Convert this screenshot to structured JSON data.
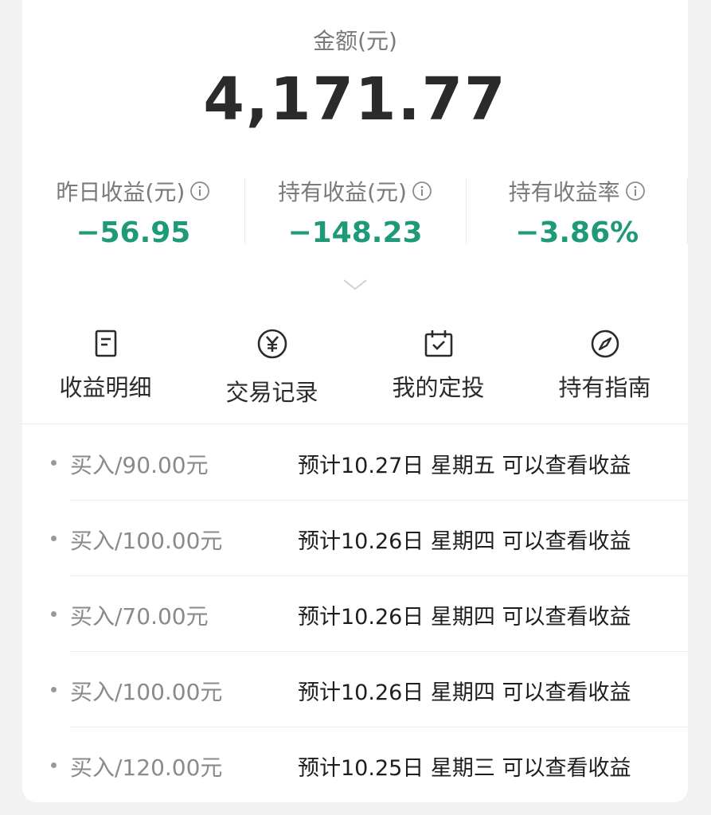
{
  "amount": {
    "label": "金额(元)",
    "value": "4,171.77"
  },
  "stats": [
    {
      "label": "昨日收益(元)",
      "value": "−56.95"
    },
    {
      "label": "持有收益(元)",
      "value": "−148.23"
    },
    {
      "label": "持有收益率",
      "value": "−3.86%"
    }
  ],
  "actions": [
    {
      "label": "收益明细",
      "icon": "document-icon"
    },
    {
      "label": "交易记录",
      "icon": "yuan-icon"
    },
    {
      "label": "我的定投",
      "icon": "calendar-check-icon"
    },
    {
      "label": "持有指南",
      "icon": "compass-icon"
    }
  ],
  "transactions": [
    {
      "buy": "买入/90.00元",
      "expect": "预计10.27日 星期五 可以查看收益"
    },
    {
      "buy": "买入/100.00元",
      "expect": "预计10.26日 星期四 可以查看收益"
    },
    {
      "buy": "买入/70.00元",
      "expect": "预计10.26日 星期四 可以查看收益"
    },
    {
      "buy": "买入/100.00元",
      "expect": "预计10.26日 星期四 可以查看收益"
    },
    {
      "buy": "买入/120.00元",
      "expect": "预计10.25日 星期三 可以查看收益"
    }
  ],
  "colors": {
    "loss": "#1e9a78",
    "text": "#2b2b2b",
    "muted": "#7a7a7a"
  }
}
